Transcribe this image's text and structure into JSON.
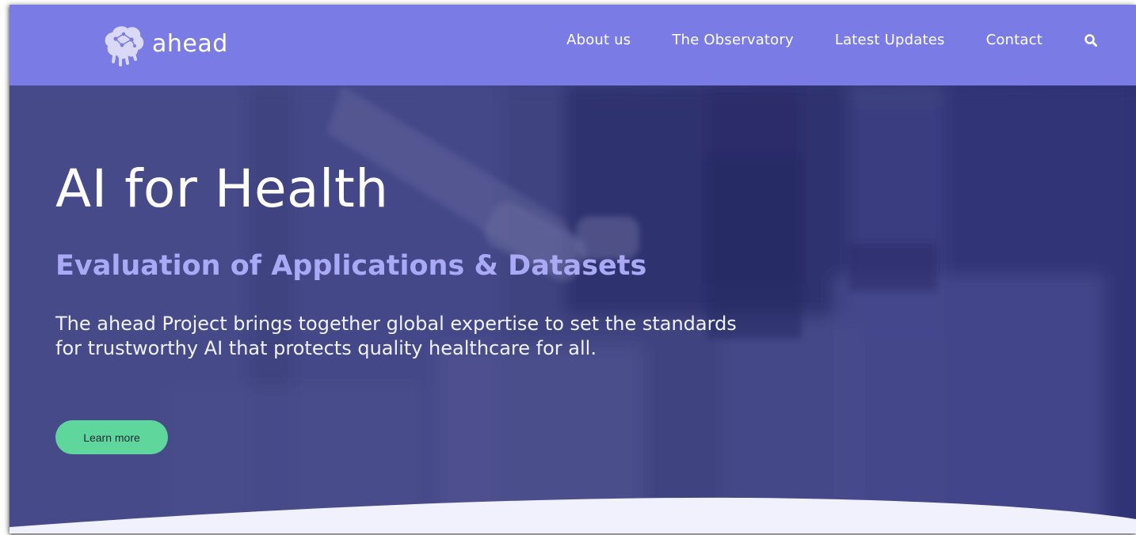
{
  "header": {
    "brand": "ahead",
    "logo_icon": "brain-network-logo",
    "nav": [
      {
        "label": "About us"
      },
      {
        "label": "The Observatory"
      },
      {
        "label": "Latest Updates"
      },
      {
        "label": "Contact"
      }
    ],
    "search_icon": "search-icon"
  },
  "hero": {
    "title": "AI for Health",
    "subtitle": "Evaluation of Applications & Datasets",
    "description": "The ahead Project brings together global expertise to set the standards for trustworthy AI that protects quality healthcare for all.",
    "cta_label": "Learn more"
  },
  "colors": {
    "header_bg": "#7b7be6",
    "subtitle": "#a9a9f6",
    "cta_bg": "#5fd69b",
    "wave": "#f1f0fd"
  }
}
